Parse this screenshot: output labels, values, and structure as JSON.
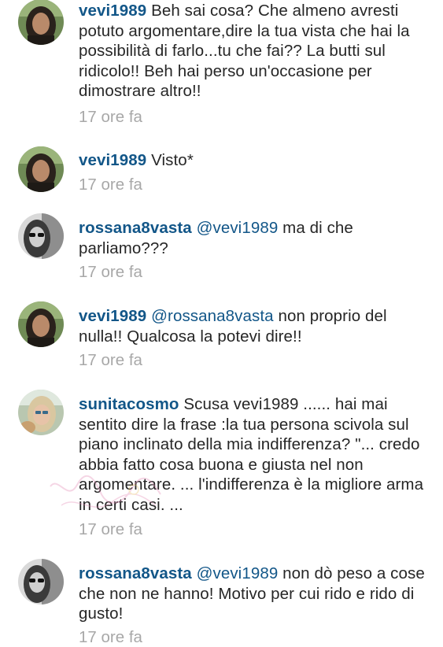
{
  "comments": [
    {
      "user": "vevi1989",
      "mention": "",
      "text": "Beh sai cosa? Che almeno avresti potuto argomentare,dire la tua vista che hai la possibilità di farlo...tu che fai?? La butti sul ridicolo!! Beh hai perso un'occasione per dimostrare altro!!",
      "time": "17 ore fa",
      "avatar_icon": "woman-portrait-dark-hair"
    },
    {
      "user": "vevi1989",
      "mention": "",
      "text": "Visto*",
      "time": "17 ore fa",
      "avatar_icon": "woman-portrait-dark-hair"
    },
    {
      "user": "rossana8vasta",
      "mention": "@vevi1989",
      "text": "ma di che parliamo???",
      "time": "17 ore fa",
      "avatar_icon": "woman-portrait-bw-sunglasses"
    },
    {
      "user": "vevi1989",
      "mention": "@rossana8vasta",
      "text": "non proprio del nulla!! Qualcosa la potevi dire!!",
      "time": "17 ore fa",
      "avatar_icon": "woman-portrait-dark-hair"
    },
    {
      "user": "sunitacosmo",
      "mention": "",
      "text": "Scusa vevi1989 ...... hai mai sentito dire la frase :la tua persona scivola sul piano inclinato della mia indifferenza? \"... credo abbia fatto cosa buona e giusta nel non argomentare. ... l'indifferenza è la migliore arma in certi casi. ...",
      "time": "17 ore fa",
      "avatar_icon": "woman-portrait-blonde"
    },
    {
      "user": "rossana8vasta",
      "mention": "@vevi1989",
      "text": "non dò peso a cose che non ne hanno! Motivo per cui rido e rido di gusto!",
      "time": "17 ore fa",
      "avatar_icon": "woman-portrait-bw-sunglasses"
    }
  ],
  "colors": {
    "username": "#125688",
    "text": "#262626",
    "timestamp": "#a8a8a8",
    "background": "#ffffff"
  },
  "watermark_icon": "pink-script-watermark"
}
